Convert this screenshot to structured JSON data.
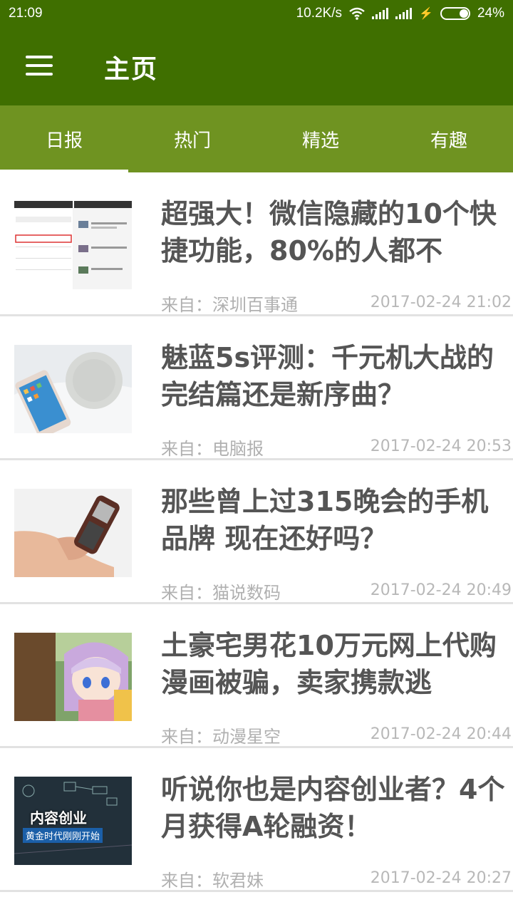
{
  "status_bar": {
    "time": "21:09",
    "speed": "10.2K/s",
    "battery_pct": "24%"
  },
  "app_bar": {
    "title": "主页",
    "menu_icon": "hamburger-menu-icon"
  },
  "tabs": [
    {
      "label": "日报",
      "active": true
    },
    {
      "label": "热门",
      "active": false
    },
    {
      "label": "精选",
      "active": false
    },
    {
      "label": "有趣",
      "active": false
    }
  ],
  "articles": [
    {
      "title": "超强大！微信隐藏的10个快捷功能，80%的人都不",
      "source": "来自：深圳百事通",
      "date": "2017-02-24 21:02",
      "thumb": "wechat-screenshot-thumbnail"
    },
    {
      "title": "魅蓝5s评测：千元机大战的完结篇还是新序曲？",
      "source": "来自：电脑报",
      "date": "2017-02-24 20:53",
      "thumb": "phone-and-speaker-thumbnail"
    },
    {
      "title": "那些曾上过315晚会的手机品牌 现在还好吗？",
      "source": "来自：猫说数码",
      "date": "2017-02-24 20:49",
      "thumb": "hand-holding-phone-thumbnail"
    },
    {
      "title": "土豪宅男花10万元网上代购漫画被骗，卖家携款逃",
      "source": "来自：动漫星空",
      "date": "2017-02-24 20:44",
      "thumb": "anime-girl-thumbnail"
    },
    {
      "title": "听说你也是内容创业者？4个月获得A轮融资！",
      "source": "来自：软君妹",
      "date": "2017-02-24 20:27",
      "thumb": "content-startup-thumbnail",
      "thumb_text_1": "内容创业",
      "thumb_text_2": "黄金时代刚刚开始"
    }
  ],
  "colors": {
    "app_bar": "#3f6f00",
    "tab_bar": "#6f9321",
    "title_text": "#555555",
    "meta_text": "#b0b0b0"
  }
}
